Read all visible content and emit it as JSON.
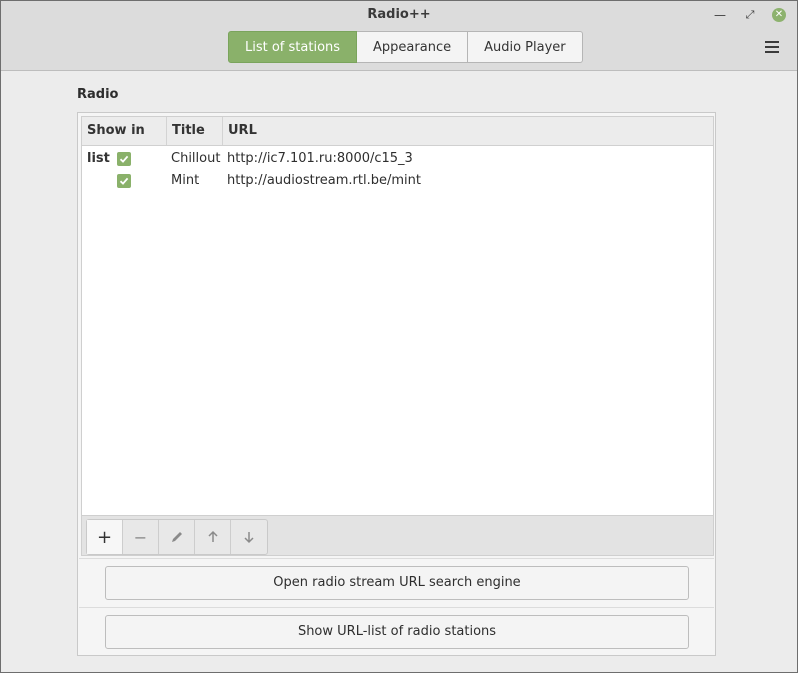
{
  "window": {
    "title": "Radio++",
    "controls": {
      "minimize": "minimize-icon",
      "maximize": "restore-icon",
      "close": "close-icon"
    }
  },
  "tabs": [
    {
      "label": "List of stations",
      "active": true
    },
    {
      "label": "Appearance",
      "active": false
    },
    {
      "label": "Audio Player",
      "active": false
    }
  ],
  "section": {
    "title": "Radio"
  },
  "table": {
    "headers": {
      "show": "Show in list",
      "title": "Title",
      "url": "URL"
    },
    "rows": [
      {
        "show": true,
        "title": "Chillout",
        "url": "http://ic7.101.ru:8000/c15_3"
      },
      {
        "show": true,
        "title": "Mint",
        "url": "http://audiostream.rtl.be/mint"
      }
    ]
  },
  "toolbar": {
    "add": "+",
    "remove": "−",
    "edit_icon": "pencil-icon",
    "up_icon": "arrow-up-icon",
    "down_icon": "arrow-down-icon"
  },
  "buttons": {
    "search_engine": "Open radio stream URL search engine",
    "url_list": "Show URL-list of radio stations"
  },
  "colors": {
    "accent": "#8ab16a",
    "close": "#8db26e"
  }
}
